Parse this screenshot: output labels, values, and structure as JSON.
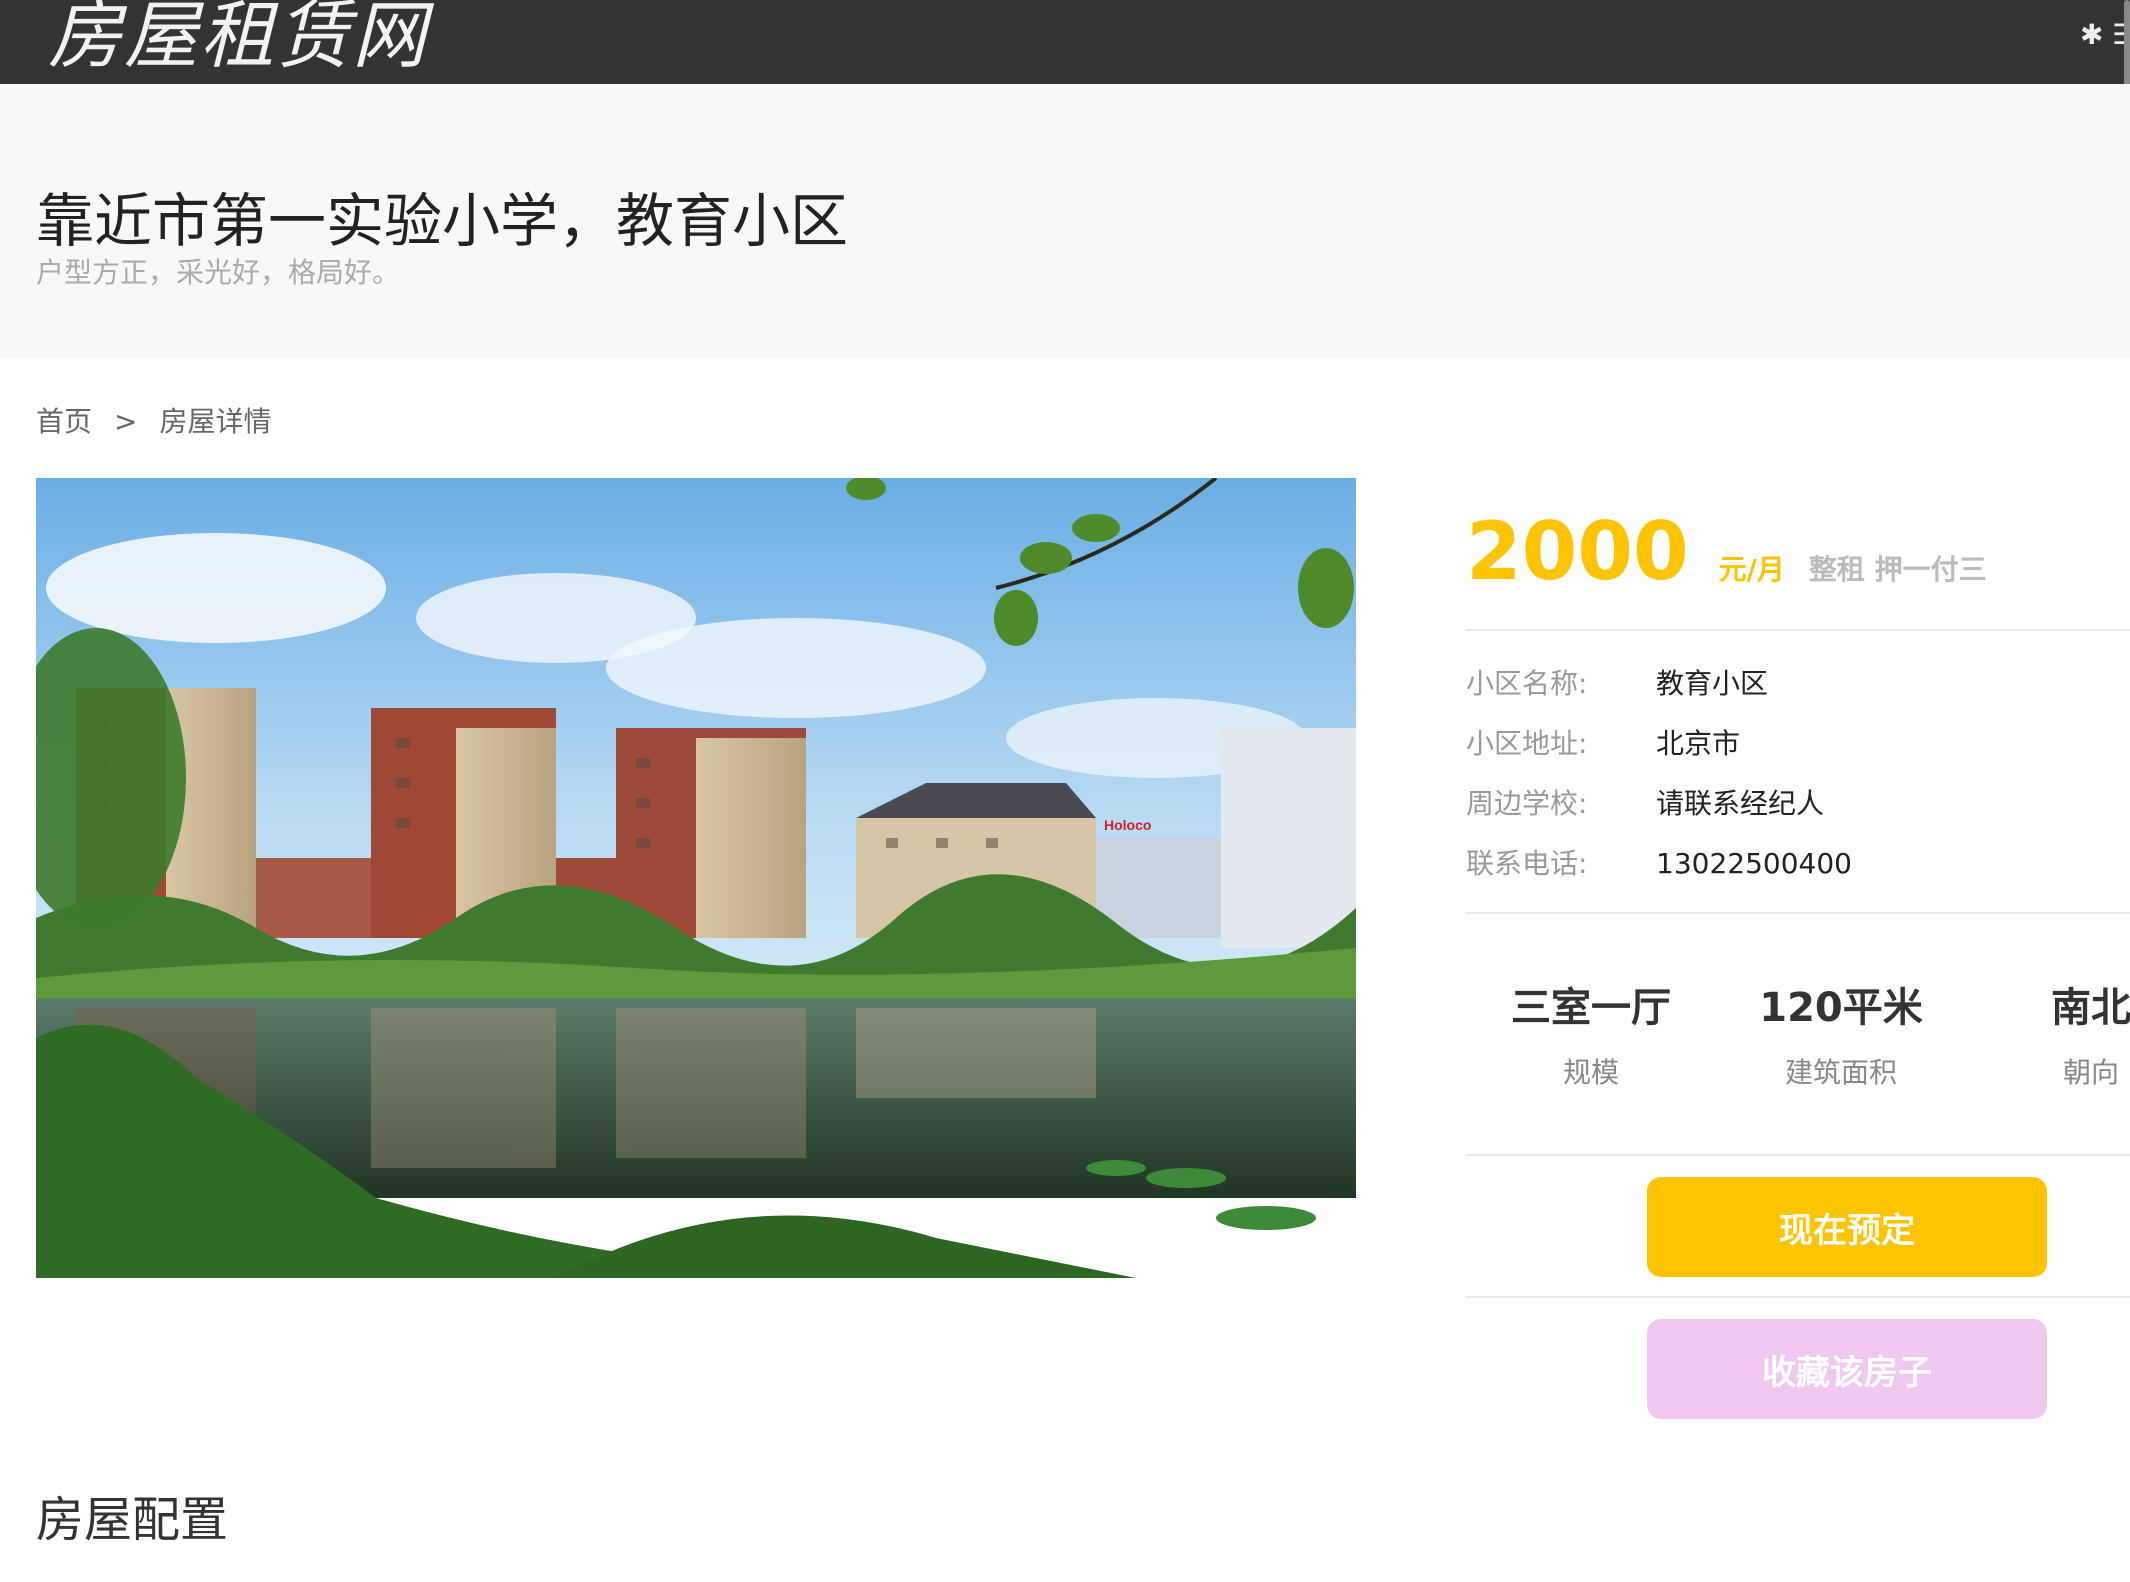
{
  "nav": {
    "logo": "房屋租赁网"
  },
  "header": {
    "title": "靠近市第一实验小学，教育小区",
    "subtitle": "户型方正，采光好，格局好。"
  },
  "breadcrumb": {
    "home": "首页",
    "separator": ">",
    "current": "房屋详情"
  },
  "price": {
    "amount": "2000",
    "unit": "元/月",
    "terms": "整租 押一付三"
  },
  "info": [
    {
      "label": "小区名称:",
      "value": "教育小区"
    },
    {
      "label": "小区地址:",
      "value": "北京市"
    },
    {
      "label": "周边学校:",
      "value": "请联系经纪人"
    },
    {
      "label": "联系电话:",
      "value": "13022500400"
    }
  ],
  "stats": [
    {
      "value": "三室一厅",
      "label": "规模"
    },
    {
      "value": "120平米",
      "label": "建筑面积"
    },
    {
      "value": "南北",
      "label": "朝向"
    }
  ],
  "buttons": {
    "book": "现在预定",
    "favorite": "收藏该房子"
  },
  "photo": {
    "sign_text": "Holoco"
  },
  "section": {
    "title": "房屋配置"
  },
  "colors": {
    "accent": "#ffc300",
    "favorite": "#efc7ef",
    "nav_bg": "#333333"
  }
}
